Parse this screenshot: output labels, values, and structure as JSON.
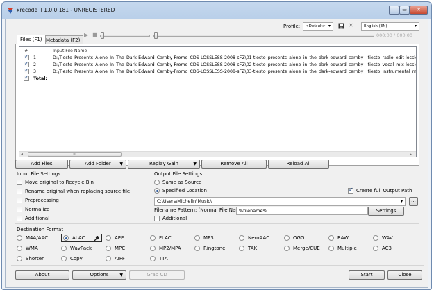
{
  "window": {
    "title": "xrecode II 1.0.0.181 - UNREGISTERED",
    "controls": {
      "minimize": "–",
      "maximize": "▭",
      "close": "✕"
    }
  },
  "toolbar": {
    "profile_label": "Profile:",
    "profile_value": "<Default>",
    "language_value": "English (EN)",
    "time_display": "000:00 / 000:00"
  },
  "tabs": [
    {
      "label": "Files (F1)",
      "active": true
    },
    {
      "label": "Metadata (F2)",
      "active": false
    }
  ],
  "file_list": {
    "columns": [
      "#",
      "Input File Name"
    ],
    "rows": [
      {
        "num": "1",
        "name": "D:\\Tiesto_Presents_Alone_In_The_Dark-Edward_Carnby-Promo_CDS-LOSSLESS-2008-sFZ\\01-tiesto_presents_alone_in_the_dark-edward_carnby__tiesto_radio_edit-lossless-sfz.fla",
        "checked": true
      },
      {
        "num": "2",
        "name": "D:\\Tiesto_Presents_Alone_In_The_Dark-Edward_Carnby-Promo_CDS-LOSSLESS-2008-sFZ\\02-tiesto_presents_alone_in_the_dark-edward_carnby__tiesto_vocal_mix-lossless-sfz.fla",
        "checked": true
      },
      {
        "num": "3",
        "name": "D:\\Tiesto_Presents_Alone_In_The_Dark-Edward_Carnby-Promo_CDS-LOSSLESS-2008-sFZ\\03-tiesto_presents_alone_in_the_dark-edward_carnby__tiesto_instrumental_mix-lossless",
        "checked": true
      }
    ],
    "total_label": "Total:",
    "scroll_grip": "III"
  },
  "actions": {
    "add_files": "Add Files",
    "add_folder": "Add Folder",
    "replay_gain": "Replay Gain",
    "remove_all": "Remove All",
    "reload_all": "Reload All"
  },
  "input_settings": {
    "title": "Input File Settings",
    "options": [
      {
        "label": "Move original to Recycle Bin",
        "checked": false
      },
      {
        "label": "Rename original when replacing source file",
        "checked": false
      },
      {
        "label": "Preprocessing",
        "checked": false
      },
      {
        "label": "Normalize",
        "checked": false
      },
      {
        "label": "Additional",
        "checked": false
      }
    ]
  },
  "output_settings": {
    "title": "Output File Settings",
    "same_as_source": "Same as Source",
    "specified_location": "Specified Location",
    "create_full_path": "Create full Output Path",
    "path_value": "C:\\Users\\Michelin\\Music\\",
    "browse_label": "...",
    "pattern_label": "Filename Pattern: (Normal File Name)",
    "pattern_value": "%filename%",
    "settings_label": "Settings",
    "additional_label": "Additional"
  },
  "destination": {
    "title": "Destination Format",
    "selected": "ALAC",
    "formats": [
      [
        "M4A/AAC",
        "ALAC",
        "APE",
        "FLAC",
        "MP3",
        "NeroAAC",
        "OGG",
        "RAW",
        "WAV"
      ],
      [
        "WMA",
        "WavPack",
        "MPC",
        "MP2/MPA",
        "Ringtone",
        "TAK",
        "Merge/CUE",
        "Multiple",
        "AC3"
      ],
      [
        "Shorten",
        "Copy",
        "AIFF",
        "TTA"
      ]
    ]
  },
  "bottom": {
    "about": "About",
    "options": "Options",
    "grab_cd": "Grab CD",
    "start": "Start",
    "close": "Close"
  },
  "colors": {
    "accent": "#2c5a9c",
    "window_frame": "#6f8bb0",
    "selected_frame": "#2b2b2b"
  }
}
